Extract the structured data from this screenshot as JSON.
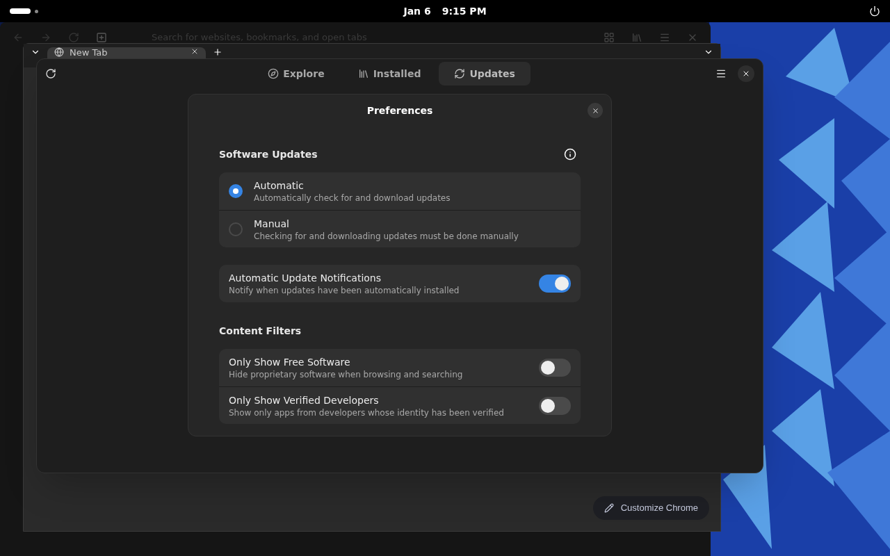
{
  "top_bar": {
    "date": "Jan 6",
    "time": "9:15 PM"
  },
  "browser_back": {
    "search_placeholder": "Search for websites, bookmarks, and open tabs"
  },
  "browser": {
    "tabs": [
      {
        "label": "New Tab",
        "selected": true
      }
    ],
    "customize_button": "Customize Chrome"
  },
  "software_window": {
    "tabs": [
      {
        "label": "Explore",
        "kind": "explore",
        "selected": false
      },
      {
        "label": "Installed",
        "kind": "installed",
        "selected": false
      },
      {
        "label": "Updates",
        "kind": "updates",
        "selected": true
      }
    ]
  },
  "dialog": {
    "title": "Preferences",
    "sections": [
      {
        "title": "Software Updates",
        "info_button": true,
        "groups": [
          {
            "rows": [
              {
                "kind": "radio",
                "title": "Automatic",
                "subtitle": "Automatically check for and download updates",
                "selected": true
              },
              {
                "kind": "radio",
                "title": "Manual",
                "subtitle": "Checking for and downloading updates must be done manually",
                "selected": false
              }
            ]
          },
          {
            "rows": [
              {
                "kind": "switch",
                "title": "Automatic Update Notifications",
                "subtitle": "Notify when updates have been automatically installed",
                "on": true
              }
            ]
          }
        ]
      },
      {
        "title": "Content Filters",
        "info_button": false,
        "groups": [
          {
            "rows": [
              {
                "kind": "switch",
                "title": "Only Show Free Software",
                "subtitle": "Hide proprietary software when browsing and searching",
                "on": false
              },
              {
                "kind": "switch",
                "title": "Only Show Verified Developers",
                "subtitle": "Show only apps from developers whose identity has been verified",
                "on": false
              }
            ]
          }
        ]
      }
    ]
  }
}
